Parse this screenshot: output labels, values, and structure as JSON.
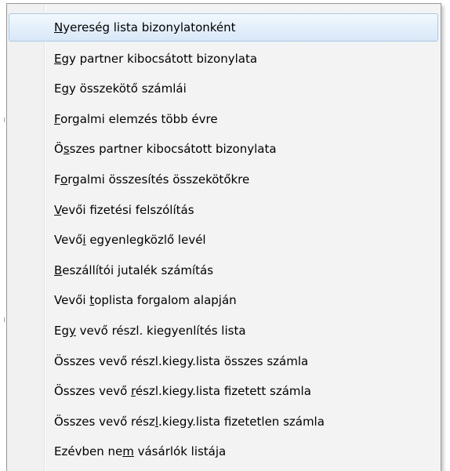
{
  "menu": {
    "items": [
      {
        "before": "",
        "accel": "N",
        "after": "yereség lista bizonylatonként",
        "highlighted": true
      },
      {
        "before": "",
        "accel": "E",
        "after": "gy partner kibocsátott bizonylata",
        "highlighted": false
      },
      {
        "before": "E",
        "accel": "g",
        "after": "y összekötő számlái",
        "highlighted": false
      },
      {
        "before": "",
        "accel": "F",
        "after": "orgalmi elemzés több évre",
        "highlighted": false
      },
      {
        "before": "Ö",
        "accel": "s",
        "after": "szes partner kibocsátott bizonylata",
        "highlighted": false
      },
      {
        "before": "F",
        "accel": "o",
        "after": "rgalmi összesítés összekötőkre",
        "highlighted": false
      },
      {
        "before": "",
        "accel": "V",
        "after": "evői fizetési felszólítás",
        "highlighted": false
      },
      {
        "before": "Vevő",
        "accel": "i",
        "after": " egyenlegközlő levél",
        "highlighted": false
      },
      {
        "before": "",
        "accel": "B",
        "after": "eszállítói jutalék számítás",
        "highlighted": false
      },
      {
        "before": "Vevői ",
        "accel": "t",
        "after": "oplista forgalom alapján",
        "highlighted": false
      },
      {
        "before": "Eg",
        "accel": "y",
        "after": " vevő részl. kiegyenlítés lista",
        "highlighted": false
      },
      {
        "before": "Összes vevő részl.kiegy.lista összes számla",
        "accel": "",
        "after": "",
        "highlighted": false
      },
      {
        "before": "Összes vevő ",
        "accel": "r",
        "after": "észl.kiegy.lista fizetett számla",
        "highlighted": false
      },
      {
        "before": "Összes vevő rész",
        "accel": "l",
        "after": ".kiegy.lista fizetetlen számla",
        "highlighted": false
      },
      {
        "before": "Ezévben ne",
        "accel": "m",
        "after": " vásárlók listája",
        "highlighted": false
      }
    ]
  }
}
